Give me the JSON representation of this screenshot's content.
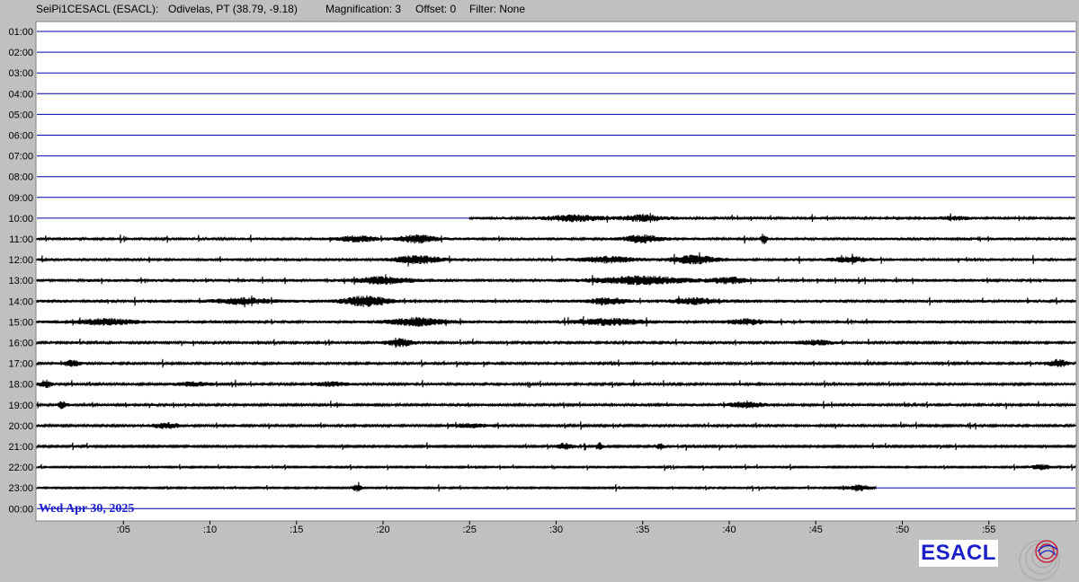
{
  "header": {
    "station": "SeiPi1CESACL (ESACL):",
    "location": "Odivelas, PT (38.79, -9.18)",
    "magnification": "Magnification: 3",
    "offset": "Offset: 0",
    "filter": "Filter: None"
  },
  "logo": {
    "text": "ESACL"
  },
  "colors": {
    "background": "#c0c0c0",
    "plot_background": "#ffffff",
    "baseline": "#0000aa",
    "trace": "#000000",
    "date_label": "#1a1fc8"
  },
  "chart_data": {
    "type": "line",
    "title": "",
    "date_label": "Wed Apr 30, 2025",
    "row_labels": [
      "01:00",
      "02:00",
      "03:00",
      "04:00",
      "05:00",
      "06:00",
      "07:00",
      "08:00",
      "09:00",
      "10:00",
      "11:00",
      "12:00",
      "13:00",
      "14:00",
      "15:00",
      "16:00",
      "17:00",
      "18:00",
      "19:00",
      "20:00",
      "21:00",
      "22:00",
      "23:00",
      "00:00"
    ],
    "x_ticks": [
      {
        "minute": 5,
        "label": ":05"
      },
      {
        "minute": 10,
        "label": ":10"
      },
      {
        "minute": 15,
        "label": ":15"
      },
      {
        "minute": 20,
        "label": ":20"
      },
      {
        "minute": 25,
        "label": ":25"
      },
      {
        "minute": 30,
        "label": ":30"
      },
      {
        "minute": 35,
        "label": ":35"
      },
      {
        "minute": 40,
        "label": ":40"
      },
      {
        "minute": 45,
        "label": ":45"
      },
      {
        "minute": 50,
        "label": ":50"
      },
      {
        "minute": 55,
        "label": ":55"
      }
    ],
    "xlim": [
      0,
      60
    ],
    "traces": [
      {
        "hour": "10:00",
        "start_minute": 25,
        "end_minute": 60,
        "base_amp": 1.5,
        "bursts": [
          {
            "minute": 31,
            "width": 3,
            "amp": 3
          },
          {
            "minute": 35,
            "width": 2.5,
            "amp": 3
          },
          {
            "minute": 53,
            "width": 1.5,
            "amp": 1.5
          }
        ]
      },
      {
        "hour": "11:00",
        "start_minute": 0,
        "end_minute": 60,
        "base_amp": 1.5,
        "bursts": [
          {
            "minute": 18.5,
            "width": 2,
            "amp": 3
          },
          {
            "minute": 22,
            "width": 2,
            "amp": 4
          },
          {
            "minute": 35,
            "width": 2,
            "amp": 4
          },
          {
            "minute": 42,
            "width": 0.3,
            "amp": 6
          }
        ]
      },
      {
        "hour": "12:00",
        "start_minute": 0,
        "end_minute": 60,
        "base_amp": 1.5,
        "bursts": [
          {
            "minute": 22,
            "width": 2.5,
            "amp": 4
          },
          {
            "minute": 33,
            "width": 3,
            "amp": 3
          },
          {
            "minute": 38,
            "width": 2.5,
            "amp": 4
          },
          {
            "minute": 47,
            "width": 2,
            "amp": 2.5
          }
        ]
      },
      {
        "hour": "13:00",
        "start_minute": 0,
        "end_minute": 60,
        "base_amp": 1.6,
        "bursts": [
          {
            "minute": 20,
            "width": 3,
            "amp": 3.5
          },
          {
            "minute": 35,
            "width": 5,
            "amp": 4
          },
          {
            "minute": 40,
            "width": 2,
            "amp": 3
          }
        ]
      },
      {
        "hour": "14:00",
        "start_minute": 0,
        "end_minute": 60,
        "base_amp": 1.6,
        "bursts": [
          {
            "minute": 12,
            "width": 3,
            "amp": 3
          },
          {
            "minute": 19,
            "width": 2.5,
            "amp": 5
          },
          {
            "minute": 33,
            "width": 2,
            "amp": 3
          },
          {
            "minute": 38,
            "width": 2.5,
            "amp": 3
          }
        ]
      },
      {
        "hour": "15:00",
        "start_minute": 0,
        "end_minute": 60,
        "base_amp": 1.6,
        "bursts": [
          {
            "minute": 4,
            "width": 3,
            "amp": 3
          },
          {
            "minute": 22,
            "width": 3,
            "amp": 4
          },
          {
            "minute": 33,
            "width": 4,
            "amp": 3
          },
          {
            "minute": 41,
            "width": 2,
            "amp": 2.5
          }
        ]
      },
      {
        "hour": "16:00",
        "start_minute": 0,
        "end_minute": 60,
        "base_amp": 1.3,
        "bursts": [
          {
            "minute": 21,
            "width": 1.5,
            "amp": 4
          },
          {
            "minute": 45,
            "width": 2,
            "amp": 2.5
          }
        ]
      },
      {
        "hour": "17:00",
        "start_minute": 0,
        "end_minute": 60,
        "base_amp": 1.3,
        "bursts": [
          {
            "minute": 2,
            "width": 1,
            "amp": 3
          },
          {
            "minute": 59,
            "width": 1,
            "amp": 4
          }
        ]
      },
      {
        "hour": "18:00",
        "start_minute": 0,
        "end_minute": 60,
        "base_amp": 1.3,
        "bursts": [
          {
            "minute": 0.5,
            "width": 0.7,
            "amp": 4
          },
          {
            "minute": 9,
            "width": 2,
            "amp": 2
          },
          {
            "minute": 17,
            "width": 2,
            "amp": 2
          }
        ]
      },
      {
        "hour": "19:00",
        "start_minute": 0,
        "end_minute": 60,
        "base_amp": 1.3,
        "bursts": [
          {
            "minute": 1.5,
            "width": 0.5,
            "amp": 4
          },
          {
            "minute": 41,
            "width": 2,
            "amp": 3
          }
        ]
      },
      {
        "hour": "20:00",
        "start_minute": 0,
        "end_minute": 60,
        "base_amp": 1.2,
        "bursts": [
          {
            "minute": 7.5,
            "width": 1.5,
            "amp": 3
          },
          {
            "minute": 25,
            "width": 2,
            "amp": 2
          }
        ]
      },
      {
        "hour": "21:00",
        "start_minute": 0,
        "end_minute": 60,
        "base_amp": 1.0,
        "bursts": [
          {
            "minute": 30.5,
            "width": 1,
            "amp": 3.5
          },
          {
            "minute": 32.5,
            "width": 0.4,
            "amp": 4
          },
          {
            "minute": 36,
            "width": 0.4,
            "amp": 4
          }
        ]
      },
      {
        "hour": "22:00",
        "start_minute": 0,
        "end_minute": 60,
        "base_amp": 0.8,
        "bursts": [
          {
            "minute": 58,
            "width": 1,
            "amp": 3
          }
        ]
      },
      {
        "hour": "23:00",
        "start_minute": 0,
        "end_minute": 48.5,
        "base_amp": 0.8,
        "bursts": [
          {
            "minute": 18.5,
            "width": 0.5,
            "amp": 4
          },
          {
            "minute": 47.5,
            "width": 1.5,
            "amp": 3
          }
        ]
      }
    ]
  }
}
